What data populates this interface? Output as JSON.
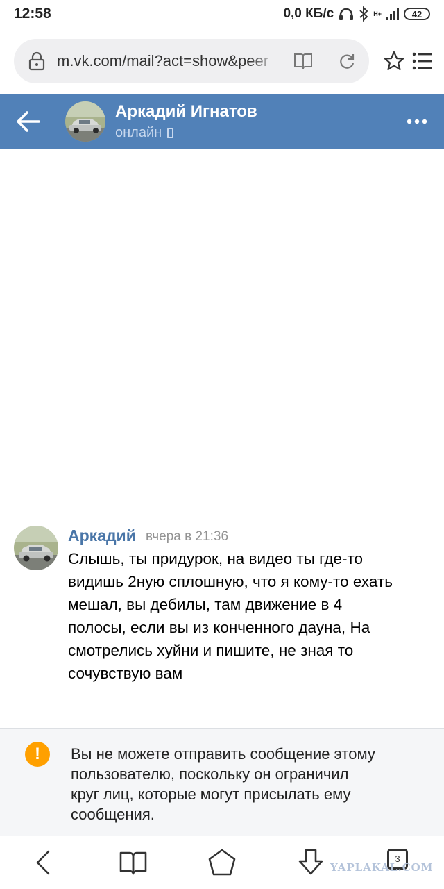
{
  "status_bar": {
    "time": "12:58",
    "speed": "0,0 КБ/с",
    "network": "H+",
    "battery": "42"
  },
  "browser": {
    "url": "m.vk.com/mail?act=show&peer",
    "icons": [
      "lock-icon",
      "reader-mode-icon",
      "reload-icon",
      "bookmark-star-icon",
      "menu-icon"
    ]
  },
  "chat_header": {
    "name": "Аркадий Игнатов",
    "status": "онлайн",
    "accent_color": "#5181b8"
  },
  "messages": [
    {
      "author": "Аркадий",
      "time": "вчера в 21:36",
      "lines": [
        "Слышь, ты придурок, на видео ты где-то",
        "видишь 2ную сплошную, что я кому-то ехать",
        "мешал, вы дебилы, там движение в 4",
        "полосы, если вы из конченного дауна, На",
        "смотрелись хуйни и пишите, не зная то",
        "сочувствую вам"
      ]
    }
  ],
  "notice": {
    "icon": "!",
    "lines": [
      "Вы не можете отправить сообщение этому",
      "пользователю, поскольку он ограничил",
      "круг лиц, которые могут присылать ему",
      "сообщения."
    ]
  },
  "bottom_nav": {
    "tab_count": "3"
  },
  "watermark": "YAPLAKAL.COM"
}
